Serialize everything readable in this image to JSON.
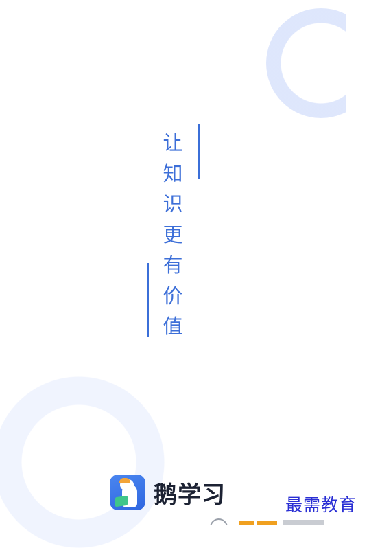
{
  "slogan": {
    "chars": [
      "让",
      "知",
      "识",
      "更",
      "有",
      "价",
      "值"
    ]
  },
  "brand": {
    "icon": "goose-mascot-icon",
    "name": "鹅学习"
  },
  "watermark": {
    "text": "最需教育"
  },
  "colors": {
    "accent": "#3d6fd8",
    "ring": "#dbe4fc",
    "brand_text": "#1c2233",
    "watermark": "#2a2fd4"
  }
}
